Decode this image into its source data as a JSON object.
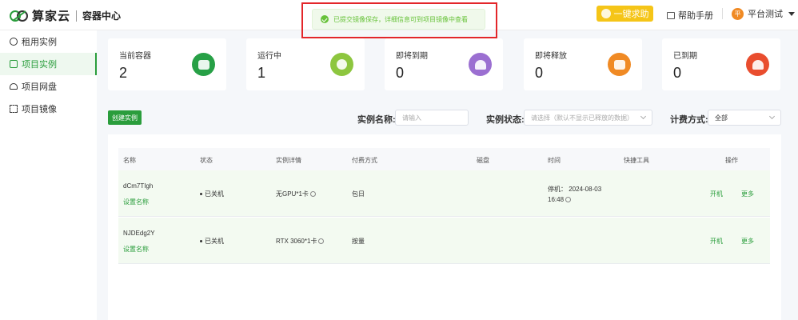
{
  "header": {
    "logo_text": "算家云",
    "logo_sub": "容器中心",
    "help_label": "一键求助",
    "manual_label": "帮助手册",
    "user_avatar": "平",
    "user_name": "平台测试"
  },
  "toast": {
    "message": "已提交镜像保存，详细信息可到项目镜像中查看"
  },
  "sidebar": {
    "items": [
      {
        "label": "租用实例",
        "icon": "rent-icon"
      },
      {
        "label": "项目实例",
        "icon": "layers-icon"
      },
      {
        "label": "项目网盘",
        "icon": "cloud-disk-icon"
      },
      {
        "label": "项目镜像",
        "icon": "image-icon"
      }
    ]
  },
  "stats": [
    {
      "title": "当前容器",
      "value": "2",
      "color": "#27a046"
    },
    {
      "title": "运行中",
      "value": "1",
      "color": "#8dc63f"
    },
    {
      "title": "即将到期",
      "value": "0",
      "color": "#9b6fd1"
    },
    {
      "title": "即将释放",
      "value": "0",
      "color": "#f08a24"
    },
    {
      "title": "已到期",
      "value": "0",
      "color": "#e94d2e"
    }
  ],
  "toolbar": {
    "create_label": "创建实例",
    "name_label": "实例名称:",
    "name_placeholder": "请输入",
    "status_label": "实例状态:",
    "status_placeholder": "请选择（默认不显示已释放的数据）",
    "billing_label": "计费方式:",
    "billing_value": "全部"
  },
  "table": {
    "columns": [
      "名称",
      "状态",
      "实例详情",
      "付费方式",
      "磁盘",
      "时间",
      "快捷工具",
      "操作"
    ],
    "rows": [
      {
        "name": "dCm7TIgh",
        "set_name": "设置名称",
        "status": "已关机",
        "detail": "无GPU*1卡",
        "billing": "包日",
        "time": "停机： 2024-08-03 16:48",
        "action1": "开机",
        "action2": "更多"
      },
      {
        "name": "NJDEdg2Y",
        "set_name": "设置名称",
        "status": "已关机",
        "detail": "RTX 3060*1卡",
        "billing": "按量",
        "time": "",
        "action1": "开机",
        "action2": "更多"
      }
    ]
  }
}
